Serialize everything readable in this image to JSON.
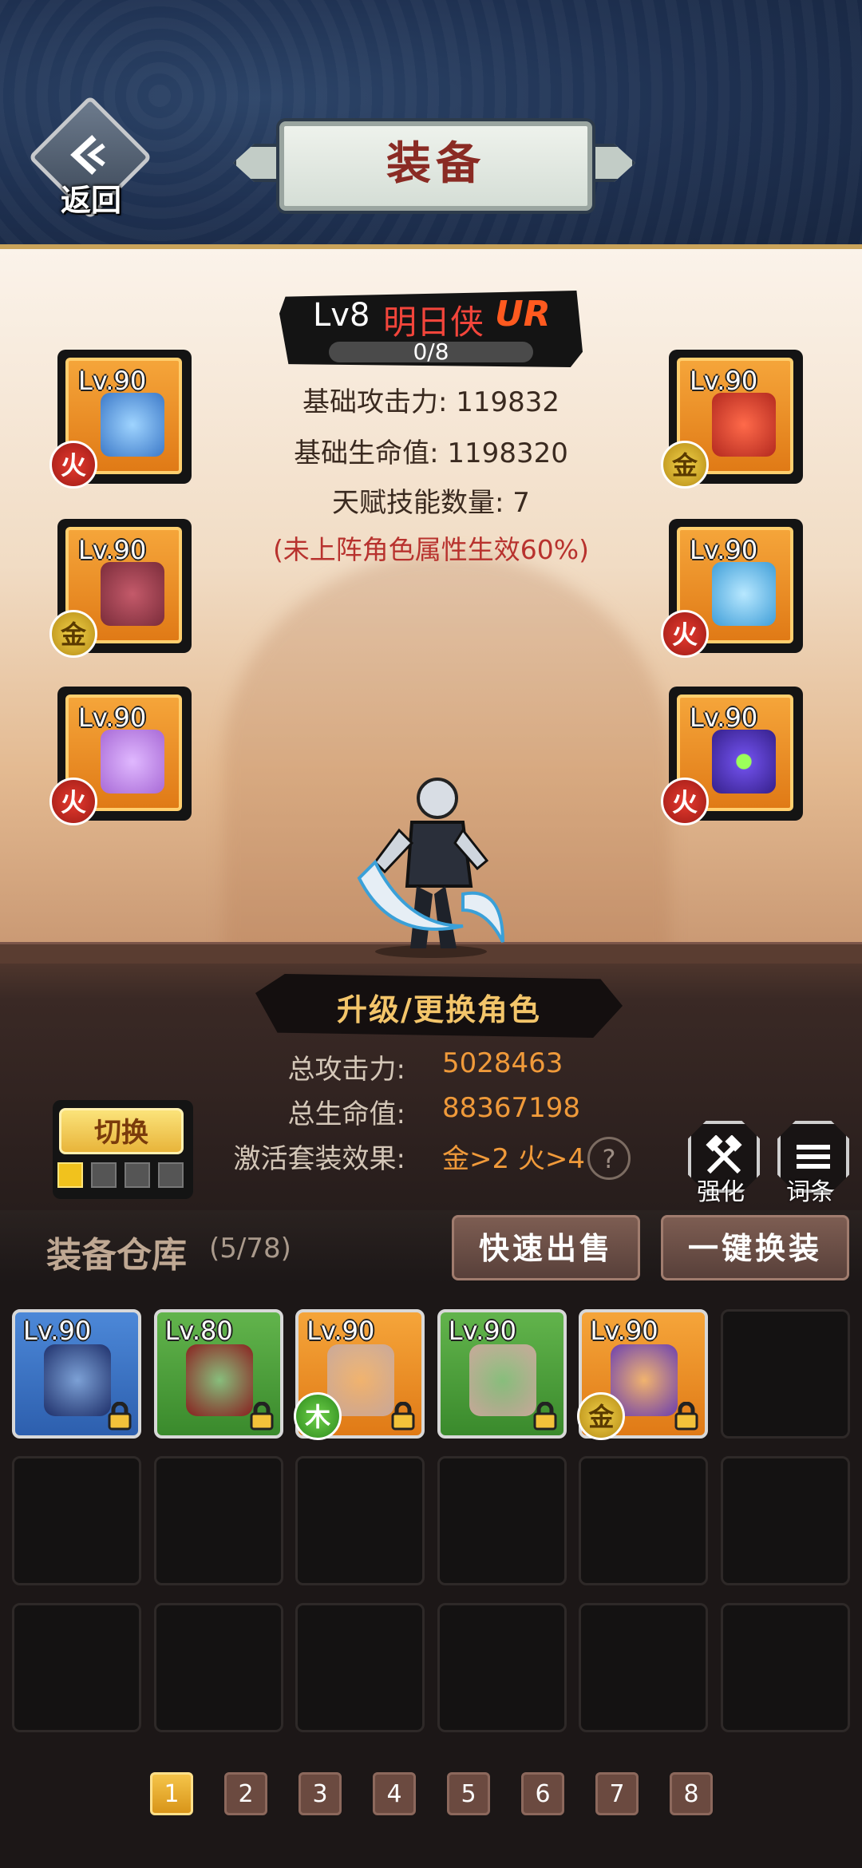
{
  "header": {
    "title": "装备",
    "back_label": "返回"
  },
  "character": {
    "level": "Lv8",
    "name": "明日侠",
    "rank": "UR",
    "progress": "0/8",
    "progress_fraction": 0,
    "stats": [
      "基础攻击力: 119832",
      "基础生命值: 1198320",
      "天赋技能数量: 7"
    ],
    "note": "(未上阵角色属性生效60%)"
  },
  "equipment_left": [
    {
      "level": "Lv.90",
      "element": "火",
      "icon": "sword-icon",
      "art_color": "#3c79c8"
    },
    {
      "level": "Lv.90",
      "element": "金",
      "icon": "helmet-icon",
      "art_color": "#7a2c3a"
    },
    {
      "level": "Lv.90",
      "element": "火",
      "icon": "necklace-icon",
      "art_color": "#a86ad6"
    }
  ],
  "equipment_right": [
    {
      "level": "Lv.90",
      "element": "金",
      "icon": "armor-icon",
      "art_color": "#b3291f"
    },
    {
      "level": "Lv.90",
      "element": "火",
      "icon": "boots-icon",
      "art_color": "#3f9ed8"
    },
    {
      "level": "Lv.90",
      "element": "火",
      "icon": "ring-icon",
      "art_color": "#6a4be0"
    }
  ],
  "upgrade_label": "升级/更换角色",
  "totals": [
    {
      "label": "总攻击力:",
      "value": "5028463"
    },
    {
      "label": "总生命值:",
      "value": "88367198"
    },
    {
      "label": "激活套装效果:",
      "value": "金>2 火>4"
    }
  ],
  "help_label": "?",
  "switch": {
    "label": "切换",
    "pages": 4,
    "active": 1
  },
  "tools": [
    {
      "label": "强化",
      "icon": "hammers-icon"
    },
    {
      "label": "词条",
      "icon": "list-icon"
    }
  ],
  "warehouse": {
    "title": "装备仓库",
    "count": "(5/78)",
    "quick_sell_label": "快速出售",
    "one_click_equip_label": "一键换装",
    "items": [
      {
        "level": "Lv.90",
        "rarity": "blue",
        "icon": "cloak-icon",
        "element": null,
        "art_color": "#1e2f6a",
        "locked": true
      },
      {
        "level": "Lv.80",
        "rarity": "green",
        "icon": "armor-icon",
        "element": null,
        "art_color": "#8a1f1f",
        "locked": true
      },
      {
        "level": "Lv.90",
        "rarity": "orange",
        "icon": "helmet-icon",
        "element": "木",
        "art_color": "#c9a89a",
        "locked": true
      },
      {
        "level": "Lv.90",
        "rarity": "green",
        "icon": "helmet-icon",
        "element": null,
        "art_color": "#c9a89a",
        "locked": true
      },
      {
        "level": "Lv.90",
        "rarity": "orange",
        "icon": "boots-icon",
        "element": "金",
        "art_color": "#6b3fb0",
        "locked": true
      }
    ],
    "total_cells": 18
  },
  "pagination": {
    "pages": [
      "1",
      "2",
      "3",
      "4",
      "5",
      "6",
      "7",
      "8"
    ],
    "active": 0
  }
}
